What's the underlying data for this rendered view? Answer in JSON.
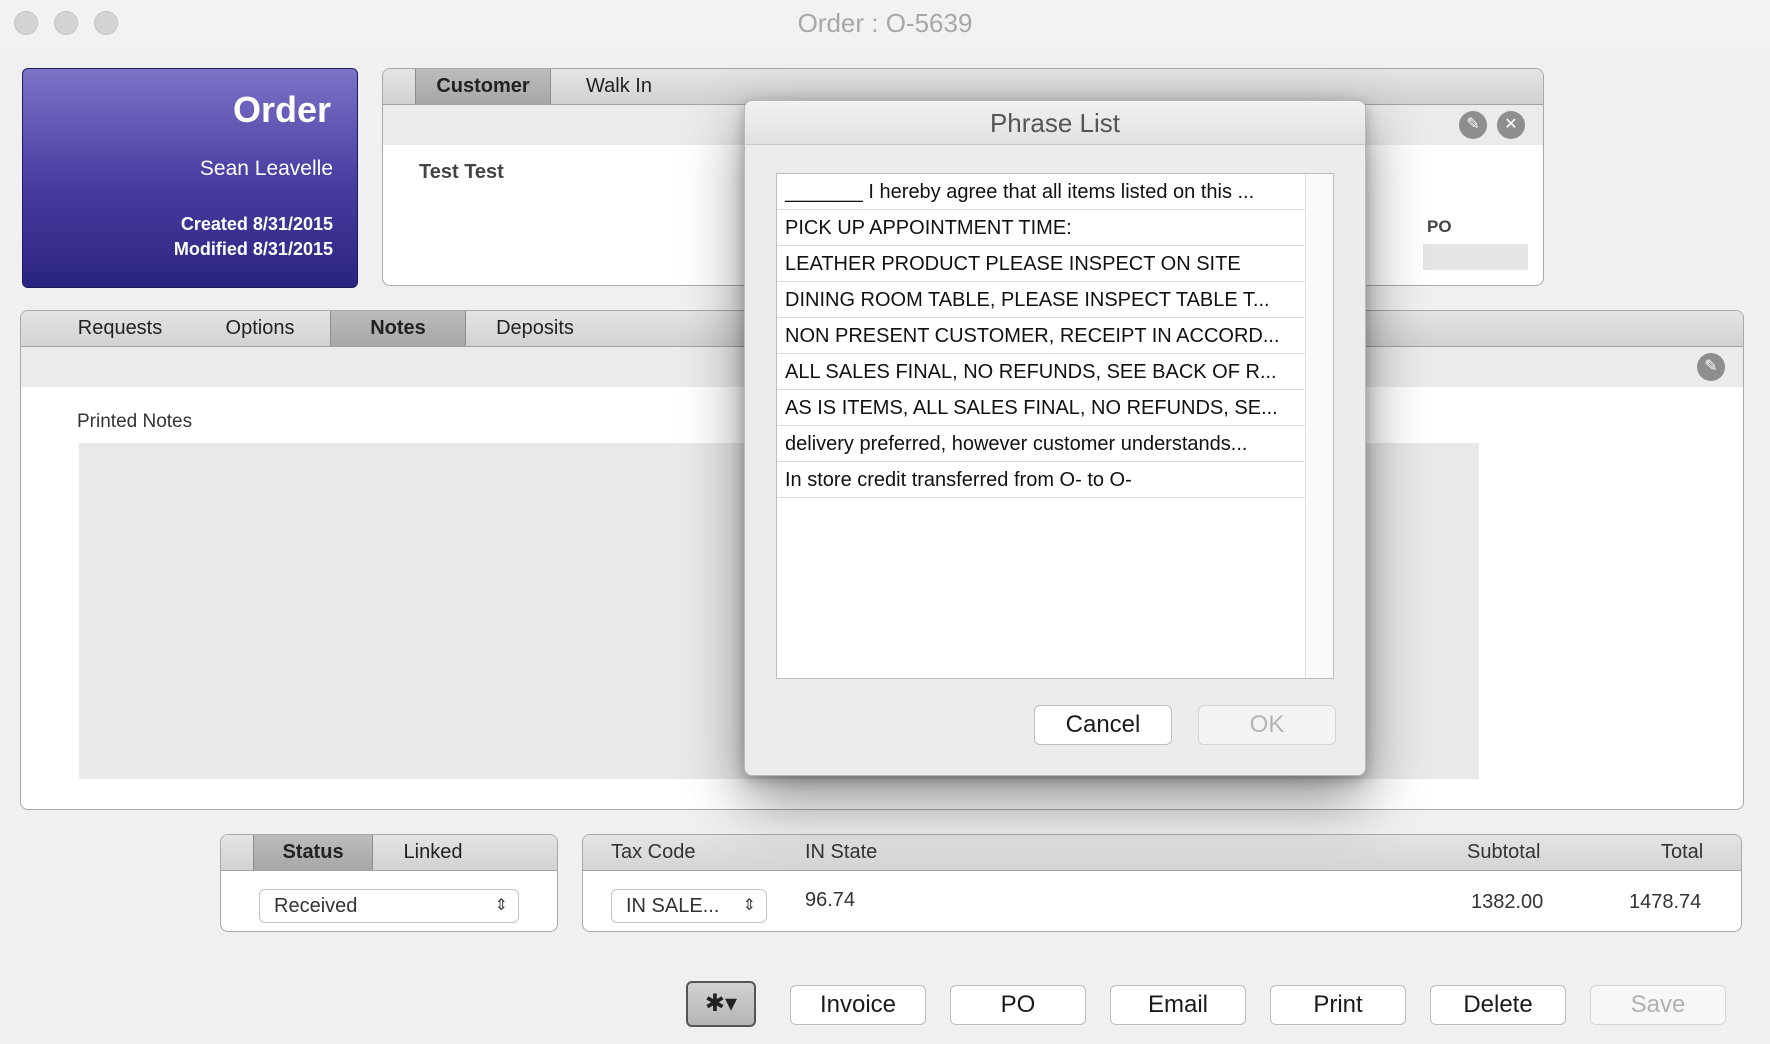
{
  "window": {
    "title": "Order : O-5639"
  },
  "order_card": {
    "title": "Order",
    "name": "Sean Leavelle",
    "created": "Created 8/31/2015",
    "modified": "Modified 8/31/2015"
  },
  "customer_panel": {
    "tabs": [
      "Customer",
      "Walk In"
    ],
    "active_tab": "Customer",
    "customer_name": "Test Test",
    "po_label": "PO",
    "icons": [
      "pencil-icon",
      "close-icon"
    ]
  },
  "notes_panel": {
    "tabs": [
      "Requests",
      "Options",
      "Notes",
      "Deposits"
    ],
    "active_tab": "Notes",
    "printed_notes_label": "Printed Notes"
  },
  "status_panel": {
    "tabs": [
      "Status",
      "Linked"
    ],
    "active_tab": "Status",
    "status_value": "Received"
  },
  "tax_panel": {
    "tax_code_label": "Tax Code",
    "tax_code_value": "IN SALE...",
    "state_label": "IN State",
    "state_value": "96.74",
    "subtotal_label": "Subtotal",
    "subtotal_value": "1382.00",
    "total_label": "Total",
    "total_value": "1478.74"
  },
  "toolbar": {
    "gear_label": "✱▾",
    "invoice": "Invoice",
    "po": "PO",
    "email": "Email",
    "print": "Print",
    "delete": "Delete",
    "save": "Save"
  },
  "phrase_dialog": {
    "title": "Phrase List",
    "items": [
      "_______ I hereby agree that all items listed on this ...",
      "PICK UP APPOINTMENT TIME:",
      "LEATHER PRODUCT PLEASE INSPECT ON SITE",
      "DINING ROOM TABLE, PLEASE INSPECT TABLE T...",
      "NON PRESENT CUSTOMER, RECEIPT IN ACCORD...",
      "ALL SALES FINAL, NO REFUNDS, SEE BACK OF R...",
      "AS IS ITEMS, ALL SALES FINAL, NO REFUNDS, SE...",
      "  delivery preferred, however customer understands...",
      "In store credit transferred from O-  to O-"
    ],
    "cancel": "Cancel",
    "ok": "OK"
  }
}
